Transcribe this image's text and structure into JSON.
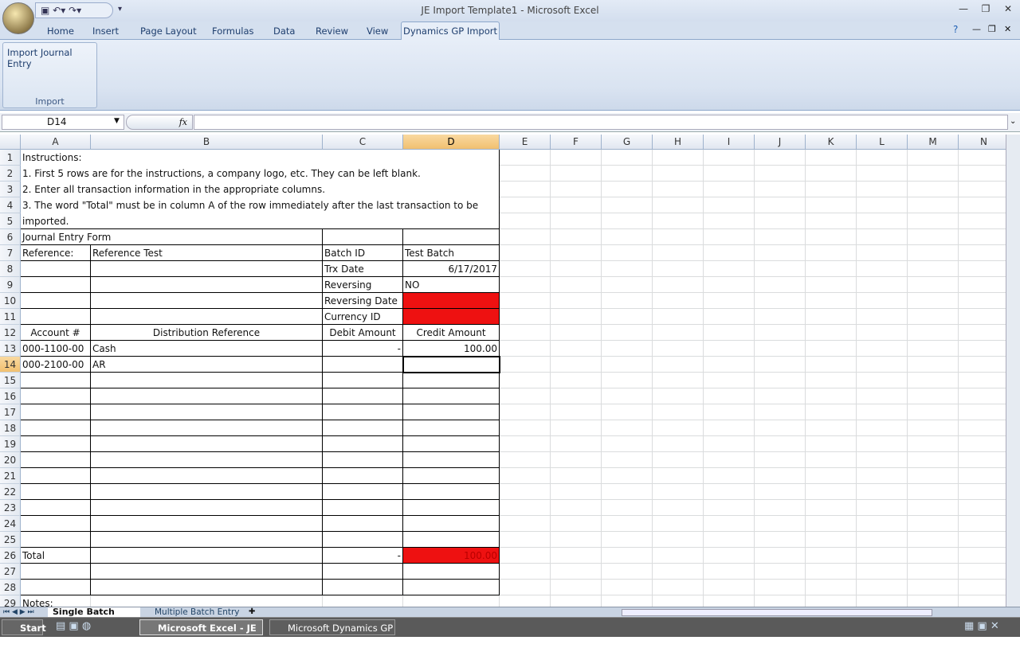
{
  "window": {
    "title": "JE Import Template1 - Microsoft Excel"
  },
  "qat": {
    "icons": [
      "save-icon",
      "undo-icon",
      "redo-icon",
      "customize-icon"
    ]
  },
  "ribbon": {
    "tabs": [
      "Home",
      "Insert",
      "Page Layout",
      "Formulas",
      "Data",
      "Review",
      "View"
    ],
    "active_tab": "Dynamics GP Import",
    "group_button": "Import Journal Entry",
    "group_label": "Import"
  },
  "formula_bar": {
    "name_box": "D14",
    "fx": "fx",
    "value": ""
  },
  "columns": [
    "A",
    "B",
    "C",
    "D",
    "E",
    "F",
    "G",
    "H",
    "I",
    "J",
    "K",
    "L",
    "M",
    "N"
  ],
  "selected_cell": "D14",
  "cells": {
    "A1": "Instructions:",
    "A2": "  1.  First 5 rows are for the instructions, a company logo, etc.  They can be left blank.",
    "A3": "  2.  Enter all transaction information in the appropriate columns.",
    "A4": "  3.  The word \"Total\" must be in column A of the row immediately after the last transaction to be",
    "A5": "imported.",
    "A6": "Journal Entry Form",
    "A7": "Reference:",
    "B7": "Reference Test",
    "C7": "Batch ID",
    "D7": "Test Batch",
    "C8": "Trx Date",
    "D8": "6/17/2017",
    "C9": "Reversing",
    "D9": "NO",
    "C10": "Reversing Date",
    "C11": "Currency ID",
    "A12": "Account #",
    "B12": "Distribution Reference",
    "C12": "Debit Amount",
    "D12": "Credit Amount",
    "A13": "000-1100-00",
    "B13": "Cash",
    "C13": "-",
    "D13": "100.00",
    "A14": "000-2100-00",
    "B14": "AR",
    "A26": "Total",
    "C26": "-",
    "D26": "100.00",
    "A29": "Notes:"
  },
  "red_cells": [
    "D10",
    "D11",
    "D26"
  ],
  "red_color": "#ee1111",
  "sheet_tabs": [
    "Single Batch Entry",
    "Multiple Batch Entry"
  ],
  "active_sheet": "Single Batch Entry",
  "taskbar": {
    "start": "Start",
    "items": [
      "Microsoft Excel - JE I...",
      "Microsoft Dynamics GP"
    ],
    "active_item": "Microsoft Excel - JE I..."
  }
}
